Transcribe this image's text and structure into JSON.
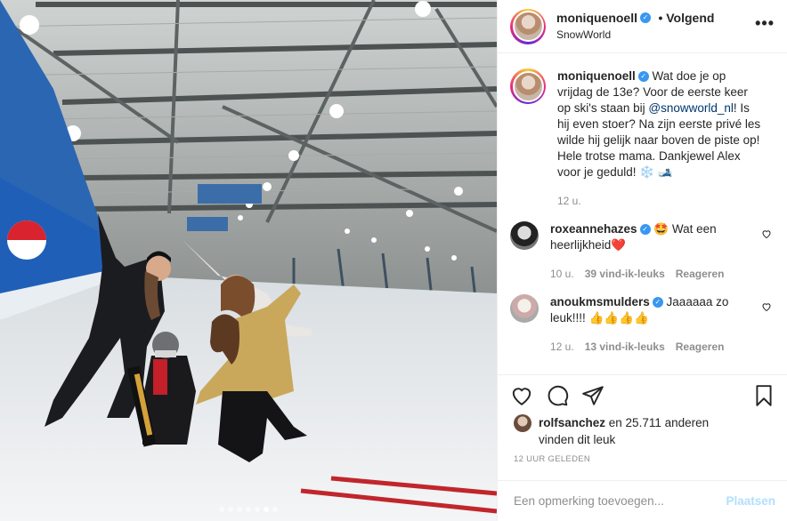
{
  "post": {
    "author": "moniquenoell",
    "follow_label": "• Volgend",
    "location": "SnowWorld",
    "more_label": "•••"
  },
  "caption": {
    "username": "moniquenoell",
    "text_before": " Wat doe je op vrijdag de 13e? Voor de eerste keer op ski's staan bij ",
    "mention": "@snowworld_nl",
    "text_after": "! Is hij even stoer? Na zijn eerste privé les wilde hij gelijk naar boven de piste op! Hele trotse mama. Dankjewel Alex voor je geduld! ❄️ 🎿",
    "time": "12 u."
  },
  "comments": [
    {
      "username": "roxeannehazes",
      "text": " 🤩 Wat een heerlijkheid❤️",
      "time": "10 u.",
      "likes": "39 vind-ik-leuks",
      "reply": "Reageren"
    },
    {
      "username": "anoukmsmulders",
      "text": " Jaaaaaa zo leuk!!!! 👍👍👍👍",
      "time": "12 u.",
      "likes": "13 vind-ik-leuks",
      "reply": "Reageren"
    }
  ],
  "likes": {
    "user": "rolfsanchez",
    "rest": " en 25.711 anderen",
    "line2": "vinden dit leuk"
  },
  "posted_ago": "12 UUR GELEDEN",
  "add_comment": {
    "placeholder": "Een opmerking toevoegen...",
    "post_label": "Plaatsen"
  },
  "carousel": {
    "count": 7,
    "active_index": 5
  },
  "colors": {
    "verified": "#3897f0",
    "link": "#00376b",
    "post_disabled": "#b2dffc",
    "heart": "#ed4956"
  }
}
